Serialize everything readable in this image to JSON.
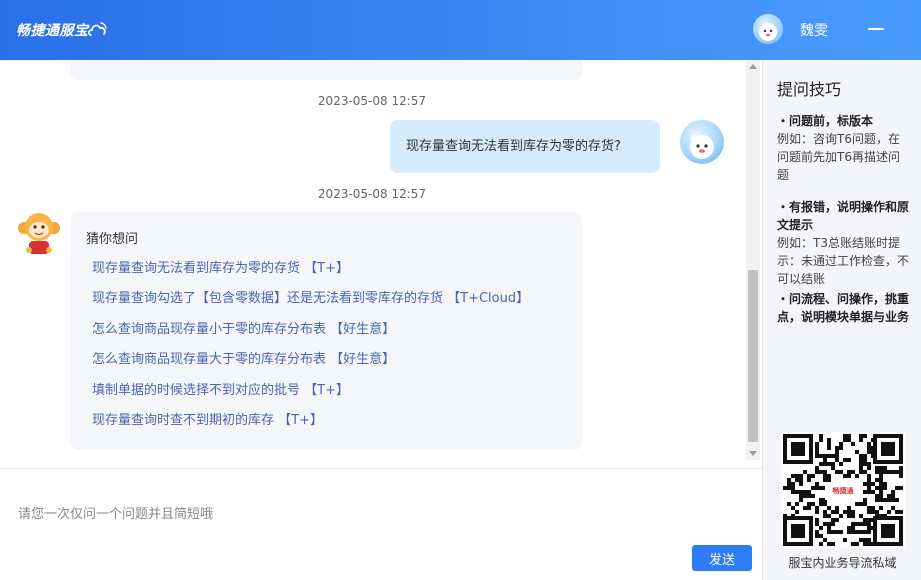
{
  "header": {
    "logo_text": "畅捷通服宝",
    "user_name": "魏雯"
  },
  "chat": {
    "messages": [
      {
        "timestamp": "2023-05-08 12:57",
        "text": "现存量查询无法看到库存为零的存货?"
      },
      {
        "timestamp": "2023-05-08 12:57",
        "guess_title": "猜你想问"
      }
    ],
    "guess_items": [
      "现存量查询无法看到库存为零的存货 【T+】",
      "现存量查询勾选了【包含零数据】还是无法看到零库存的存货 【T+Cloud】",
      "怎么查询商品现存量小于零的库存分布表 【好生意】",
      "怎么查询商品现存量大于零的库存分布表 【好生意】",
      "填制单据的时候选择不到对应的批号 【T+】",
      "现存量查询时查不到期初的库存 【T+】"
    ]
  },
  "input": {
    "placeholder": "请您一次仅问一个问题并且简短哦",
    "send_label": "发送"
  },
  "sidebar": {
    "title": "提问技巧",
    "tips": [
      {
        "head": "・问题前，标版本",
        "body": "例如：咨询T6问题，在问题前先加T6再描述问题"
      },
      {
        "head": "・有报错，说明操作和原文提示",
        "body": "例如：T3总账结账时提示：未通过工作检查，不可以结账"
      },
      {
        "head": "・问流程、问操作，挑重点，说明模块单据与业务",
        "body": ""
      }
    ],
    "qr_logo_text": "畅捷通",
    "qr_caption": "服宝内业务导流私域"
  },
  "colors": {
    "header_blue": "#3d8cf6",
    "link_blue": "#4a66b0",
    "send_button": "#2e7cf6",
    "user_bubble": "#d6ebfd"
  }
}
